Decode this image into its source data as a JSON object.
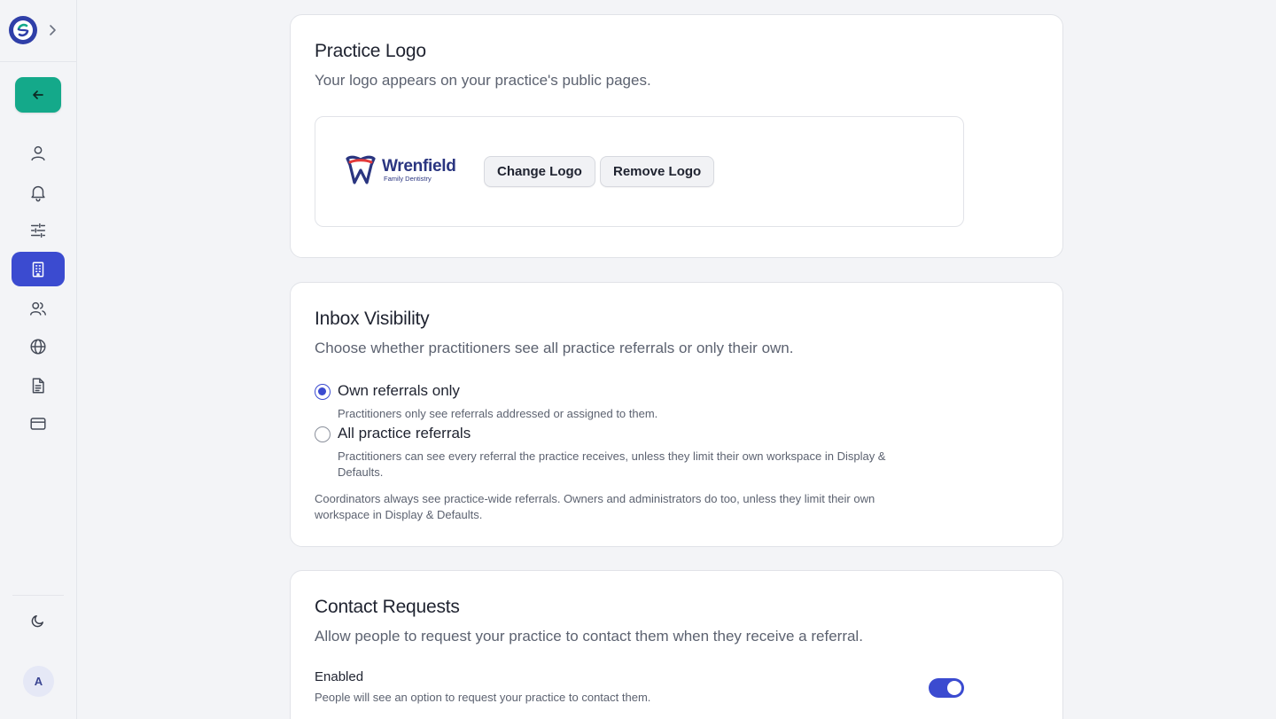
{
  "colors": {
    "accent": "#3b4bd0",
    "back_button": "#14a98a",
    "background": "#f3f4f7"
  },
  "sidebar": {
    "brand_icon": "app-logo-icon",
    "expand_icon": "chevron-right-icon",
    "back_icon": "arrow-left-icon",
    "items": [
      {
        "icon": "user-icon",
        "active": false
      },
      {
        "icon": "bell-icon",
        "active": false
      },
      {
        "icon": "sliders-icon",
        "active": false
      },
      {
        "icon": "building-icon",
        "active": true
      },
      {
        "icon": "users-icon",
        "active": false
      },
      {
        "icon": "globe-icon",
        "active": false
      },
      {
        "icon": "document-icon",
        "active": false
      },
      {
        "icon": "credit-card-icon",
        "active": false
      }
    ],
    "theme_icon": "moon-icon",
    "avatar_initial": "A"
  },
  "practice_logo": {
    "title": "Practice Logo",
    "description": "Your logo appears on your practice's public pages.",
    "logo_name": "Wrenfield",
    "logo_subtitle": "Family Dentistry",
    "change_label": "Change Logo",
    "remove_label": "Remove Logo"
  },
  "inbox_visibility": {
    "title": "Inbox Visibility",
    "description": "Choose whether practitioners see all practice referrals or only their own.",
    "options": [
      {
        "label": "Own referrals only",
        "help": "Practitioners only see referrals addressed or assigned to them.",
        "selected": true
      },
      {
        "label": "All practice referrals",
        "help": "Practitioners can see every referral the practice receives, unless they limit their own workspace in Display & Defaults.",
        "selected": false
      }
    ],
    "note": "Coordinators always see practice-wide referrals. Owners and administrators do too, unless they limit their own workspace in Display & Defaults."
  },
  "contact_requests": {
    "title": "Contact Requests",
    "description": "Allow people to request your practice to contact them when they receive a referral.",
    "toggle_label": "Enabled",
    "toggle_help": "People will see an option to request your practice to contact them.",
    "enabled": true
  }
}
